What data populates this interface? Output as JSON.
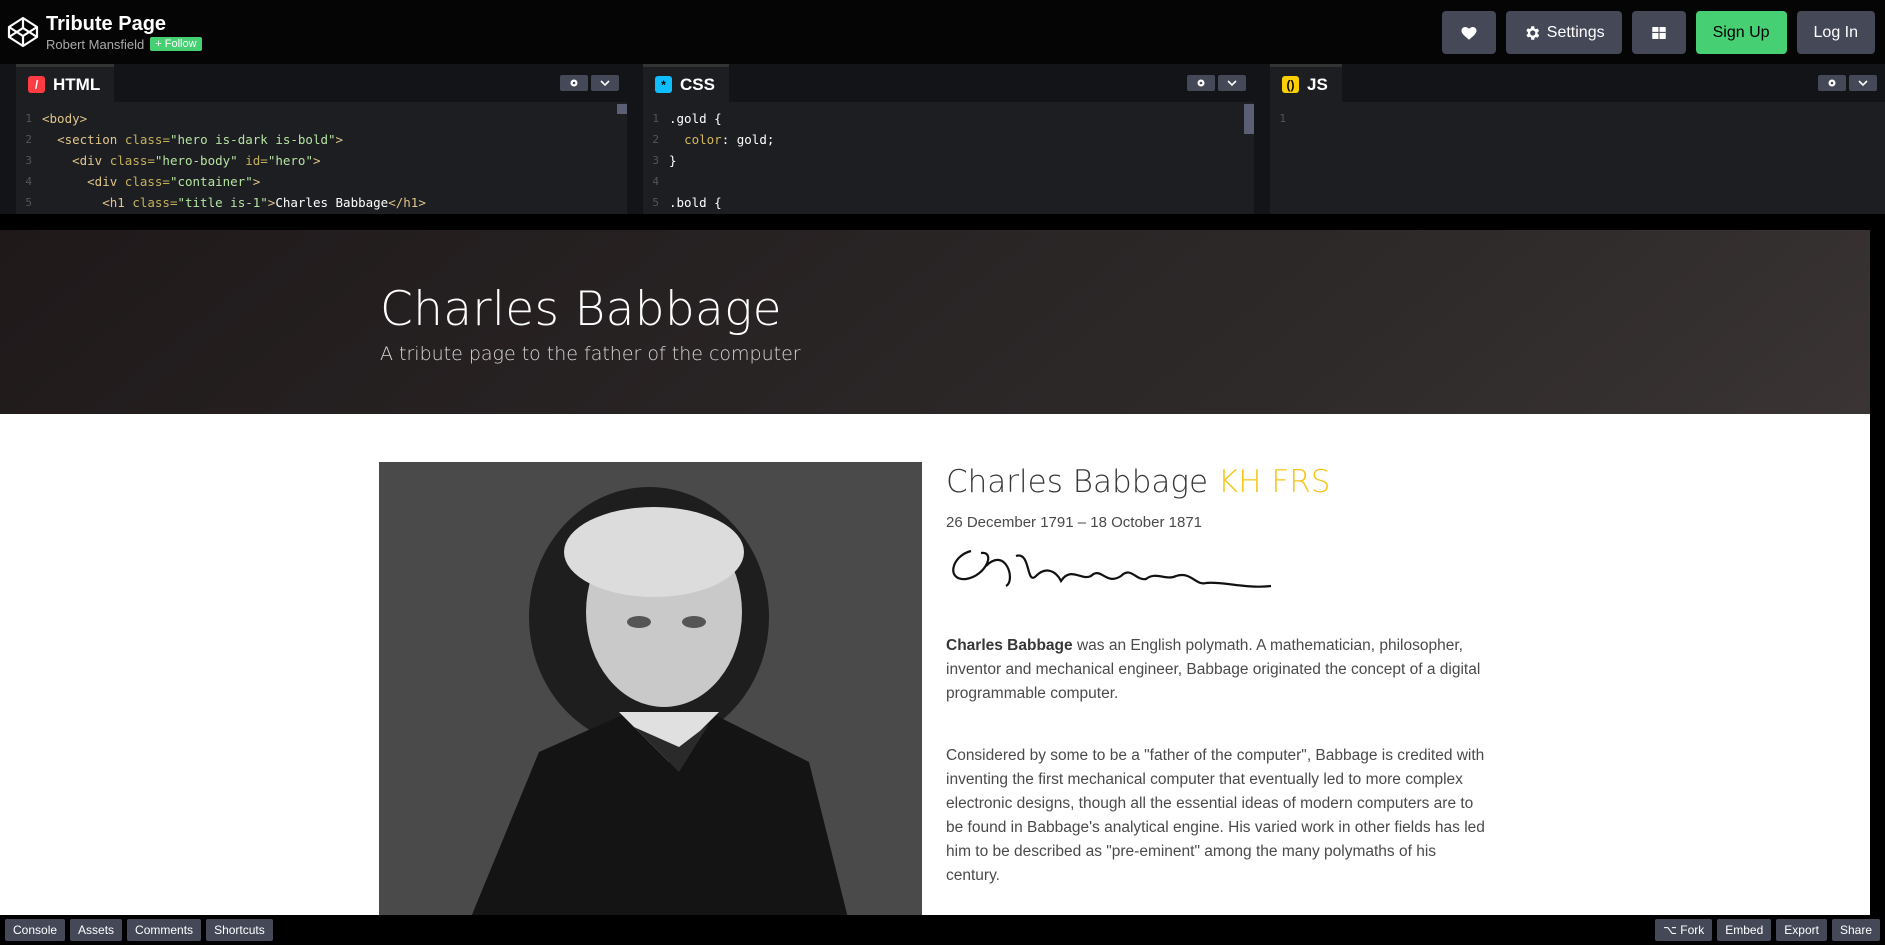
{
  "header": {
    "pen_title": "Tribute Page",
    "author": "Robert Mansfield",
    "follow_label": "+ Follow",
    "settings_label": "Settings",
    "signup_label": "Sign Up",
    "login_label": "Log In"
  },
  "editors": {
    "html": {
      "label": "HTML",
      "lines": [
        "1",
        "2",
        "3",
        "4",
        "5"
      ]
    },
    "css": {
      "label": "CSS",
      "lines": [
        "1",
        "2",
        "3",
        "4",
        "5"
      ]
    },
    "js": {
      "label": "JS",
      "lines": [
        "1"
      ]
    }
  },
  "preview": {
    "hero_title": "Charles Babbage",
    "hero_subtitle": "A tribute page to the father of the computer",
    "bio_name": "Charles Babbage",
    "bio_honours": "KH FRS",
    "dates": "26 December 1791 – 18 October 1871",
    "para1_bold": "Charles Babbage",
    "para1_rest": " was an English polymath. A mathematician, philosopher, inventor and mechanical engineer, Babbage originated the concept of a digital programmable computer.",
    "para2": "Considered by some to be a \"father of the computer\", Babbage is credited with inventing the first mechanical computer that eventually led to more complex electronic designs, though all the essential ideas of modern computers are to be found in Babbage's analytical engine. His varied work in other fields has led him to be described as \"pre-eminent\" among the many polymaths of his century."
  },
  "footer": {
    "console": "Console",
    "assets": "Assets",
    "comments": "Comments",
    "shortcuts": "Shortcuts",
    "fork": "⌥ Fork",
    "embed": "Embed",
    "export": "Export",
    "share": "Share"
  },
  "colors": {
    "accent_green": "#47cf73",
    "gold": "#f5c518",
    "html_icon": "#ff3c41",
    "css_icon": "#0ebeff",
    "js_icon": "#fcd000"
  }
}
